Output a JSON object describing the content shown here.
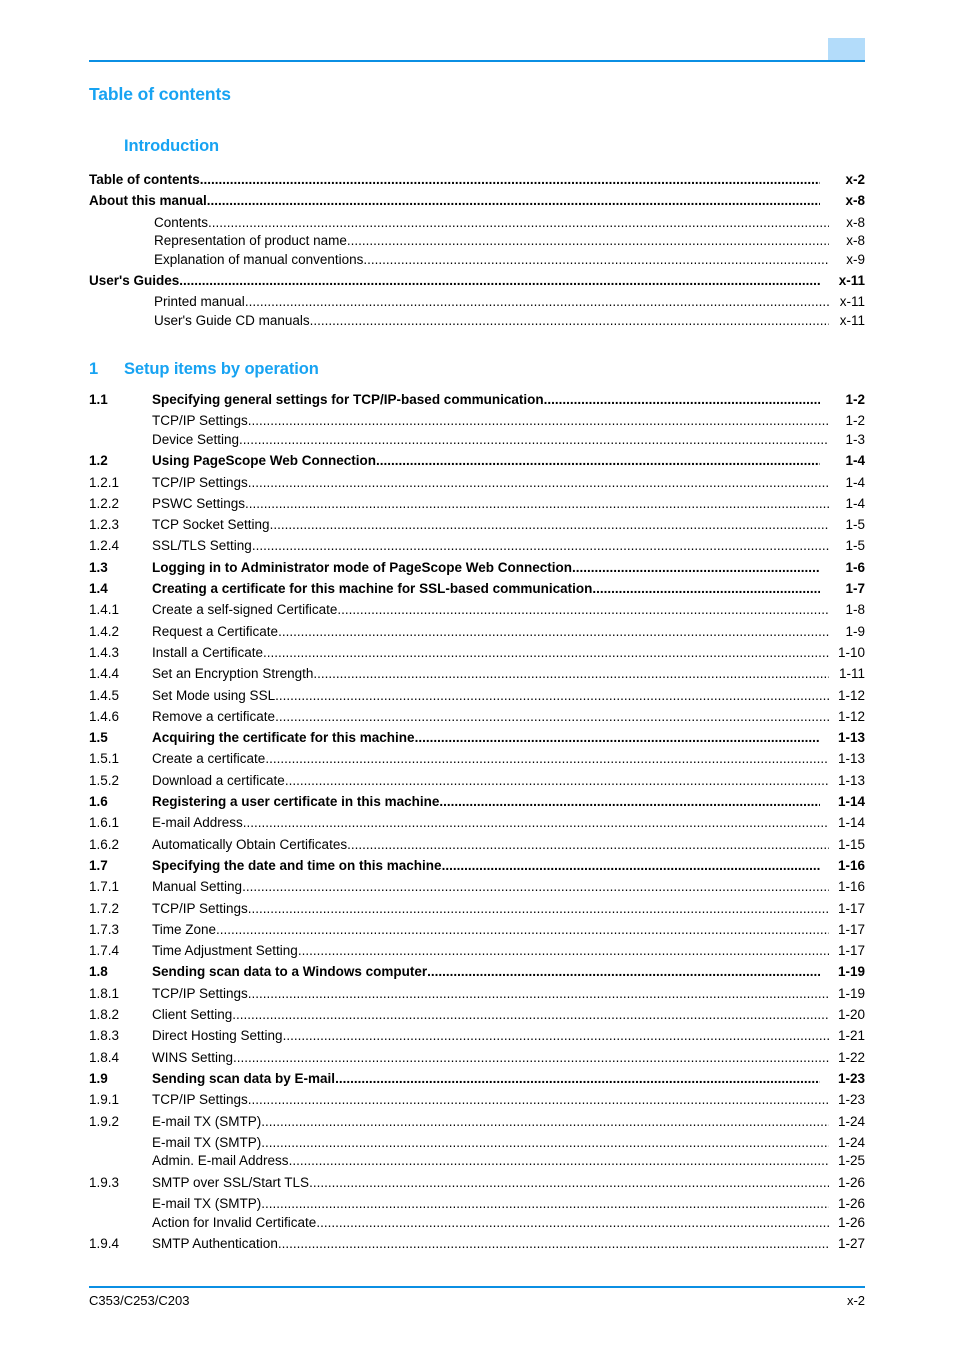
{
  "header": {
    "tab_marker": "chapter-tab"
  },
  "doc_title": "Table of contents",
  "intro": {
    "title": "Introduction",
    "entries": [
      {
        "level": 1,
        "num": "",
        "label": "Table of contents",
        "page": "x-2"
      },
      {
        "level": 1,
        "num": "",
        "label": "About this manual",
        "page": "x-8"
      },
      {
        "level": 3,
        "num": "",
        "label": "Contents",
        "page": "x-8"
      },
      {
        "level": 3,
        "num": "",
        "label": "Representation of product name",
        "page": "x-8"
      },
      {
        "level": 3,
        "num": "",
        "label": "Explanation of manual conventions",
        "page": "x-9"
      },
      {
        "level": 1,
        "num": "",
        "label": "User's Guides",
        "page": "x-11"
      },
      {
        "level": 3,
        "num": "",
        "label": "Printed manual",
        "page": "x-11"
      },
      {
        "level": 3,
        "num": "",
        "label": "User's Guide CD manuals",
        "page": "x-11"
      }
    ]
  },
  "chapter1": {
    "number": "1",
    "title": "Setup items by operation",
    "entries": [
      {
        "level": 1,
        "num": "1.1",
        "label": "Specifying general settings for TCP/IP-based communication",
        "page": "1-2"
      },
      {
        "level": 3,
        "num": "",
        "label": "TCP/IP Settings",
        "page": "1-2"
      },
      {
        "level": 3,
        "num": "",
        "label": "Device Setting",
        "page": "1-3"
      },
      {
        "level": 1,
        "num": "1.2",
        "label": "Using PageScope Web Connection",
        "page": "1-4"
      },
      {
        "level": 2,
        "num": "1.2.1",
        "label": "TCP/IP Settings",
        "page": "1-4"
      },
      {
        "level": 2,
        "num": "1.2.2",
        "label": "PSWC Settings",
        "page": "1-4"
      },
      {
        "level": 2,
        "num": "1.2.3",
        "label": "TCP Socket Setting",
        "page": "1-5"
      },
      {
        "level": 2,
        "num": "1.2.4",
        "label": "SSL/TLS Setting",
        "page": "1-5"
      },
      {
        "level": 1,
        "num": "1.3",
        "label": "Logging in to Administrator mode of PageScope Web Connection",
        "page": "1-6"
      },
      {
        "level": 1,
        "num": "1.4",
        "label": "Creating a certificate for this machine for SSL-based communication",
        "page": "1-7"
      },
      {
        "level": 2,
        "num": "1.4.1",
        "label": "Create a self-signed Certificate",
        "page": "1-8"
      },
      {
        "level": 2,
        "num": "1.4.2",
        "label": "Request a Certificate",
        "page": "1-9"
      },
      {
        "level": 2,
        "num": "1.4.3",
        "label": "Install a Certificate",
        "page": "1-10"
      },
      {
        "level": 2,
        "num": "1.4.4",
        "label": "Set an Encryption Strength",
        "page": "1-11"
      },
      {
        "level": 2,
        "num": "1.4.5",
        "label": "Set Mode using SSL",
        "page": "1-12"
      },
      {
        "level": 2,
        "num": "1.4.6",
        "label": "Remove a certificate",
        "page": "1-12"
      },
      {
        "level": 1,
        "num": "1.5",
        "label": "Acquiring the certificate for this machine",
        "page": "1-13"
      },
      {
        "level": 2,
        "num": "1.5.1",
        "label": "Create a certificate",
        "page": "1-13"
      },
      {
        "level": 2,
        "num": "1.5.2",
        "label": "Download a certificate",
        "page": "1-13"
      },
      {
        "level": 1,
        "num": "1.6",
        "label": "Registering a user certificate in this machine",
        "page": "1-14"
      },
      {
        "level": 2,
        "num": "1.6.1",
        "label": "E-mail Address",
        "page": "1-14"
      },
      {
        "level": 2,
        "num": "1.6.2",
        "label": "Automatically Obtain Certificates",
        "page": "1-15"
      },
      {
        "level": 1,
        "num": "1.7",
        "label": "Specifying the date and time on this machine",
        "page": "1-16"
      },
      {
        "level": 2,
        "num": "1.7.1",
        "label": "Manual Setting",
        "page": "1-16"
      },
      {
        "level": 2,
        "num": "1.7.2",
        "label": "TCP/IP Settings",
        "page": "1-17"
      },
      {
        "level": 2,
        "num": "1.7.3",
        "label": "Time Zone",
        "page": "1-17"
      },
      {
        "level": 2,
        "num": "1.7.4",
        "label": "Time Adjustment Setting",
        "page": "1-17"
      },
      {
        "level": 1,
        "num": "1.8",
        "label": "Sending scan data to a Windows computer",
        "page": "1-19"
      },
      {
        "level": 2,
        "num": "1.8.1",
        "label": "TCP/IP Settings",
        "page": "1-19"
      },
      {
        "level": 2,
        "num": "1.8.2",
        "label": "Client Setting",
        "page": "1-20"
      },
      {
        "level": 2,
        "num": "1.8.3",
        "label": "Direct Hosting Setting",
        "page": "1-21"
      },
      {
        "level": 2,
        "num": "1.8.4",
        "label": "WINS Setting",
        "page": "1-22"
      },
      {
        "level": 1,
        "num": "1.9",
        "label": "Sending scan data by E-mail",
        "page": "1-23"
      },
      {
        "level": 2,
        "num": "1.9.1",
        "label": "TCP/IP Settings",
        "page": "1-23"
      },
      {
        "level": 2,
        "num": "1.9.2",
        "label": "E-mail TX (SMTP)",
        "page": "1-24"
      },
      {
        "level": 3,
        "num": "",
        "label": "E-mail TX (SMTP)",
        "page": "1-24"
      },
      {
        "level": 3,
        "num": "",
        "label": "Admin. E-mail Address",
        "page": "1-25"
      },
      {
        "level": 2,
        "num": "1.9.3",
        "label": "SMTP over SSL/Start TLS",
        "page": "1-26"
      },
      {
        "level": 3,
        "num": "",
        "label": "E-mail TX (SMTP)",
        "page": "1-26"
      },
      {
        "level": 3,
        "num": "",
        "label": "Action for Invalid Certificate",
        "page": "1-26"
      },
      {
        "level": 2,
        "num": "1.9.4",
        "label": "SMTP Authentication",
        "page": "1-27"
      }
    ]
  },
  "footer": {
    "models": "C353/C253/C203",
    "page_number": "x-2"
  },
  "colors": {
    "accent_blue": "#17a3f2",
    "rule_blue": "#0b8fe3",
    "tab_blue": "#b3dcfa"
  }
}
